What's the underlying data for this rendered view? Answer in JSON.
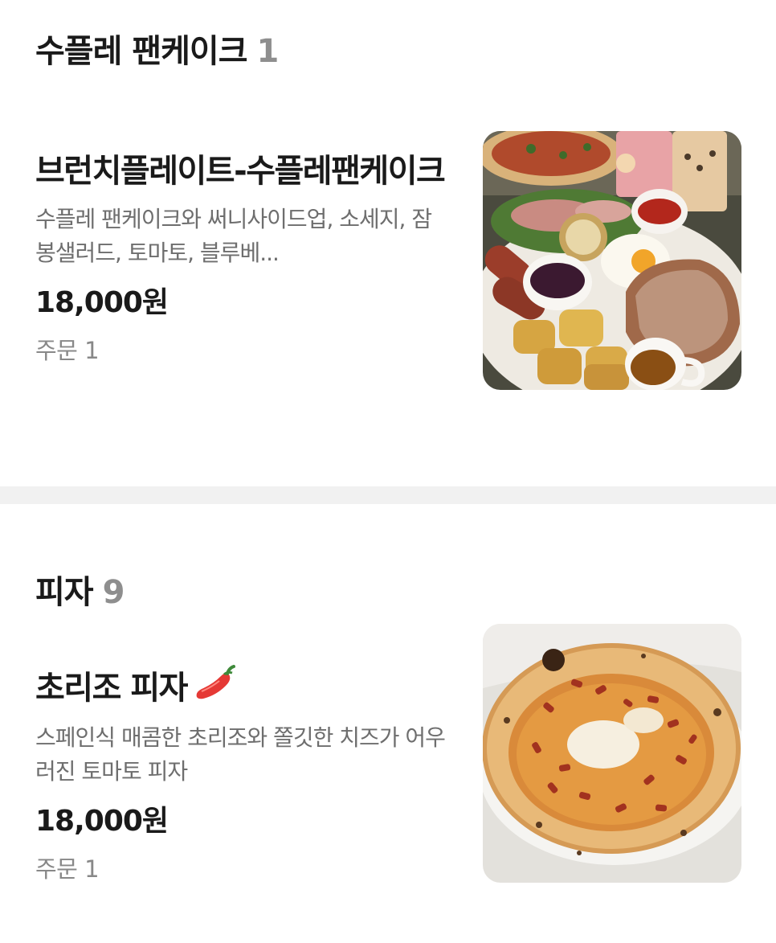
{
  "sections": [
    {
      "title": "수플레 팬케이크",
      "count": "1",
      "items": [
        {
          "name": "브런치플레이트-수플레팬케이크",
          "description": "수플레 팬케이크와 써니사이드업, 소세지, 잠봉샐러드, 토마토, 블루베...",
          "price": "18,000원",
          "orders": "주문 1",
          "image": "brunch-plate-photo"
        }
      ]
    },
    {
      "title": "피자",
      "count": "9",
      "items": [
        {
          "name": "초리조 피자",
          "spicy_icon": "chili-pepper-icon",
          "description": "스페인식 매콤한 초리조와 쫄깃한 치즈가 어우러진 토마토 피자",
          "price": "18,000원",
          "orders": "주문 1",
          "image": "chorizo-pizza-photo"
        }
      ]
    }
  ],
  "colors": {
    "text": "#1a1a1a",
    "secondary_text": "#6e6e6e",
    "count_text": "#8e8e8e",
    "divider": "#f1f1f1",
    "chili": "#e53935"
  }
}
